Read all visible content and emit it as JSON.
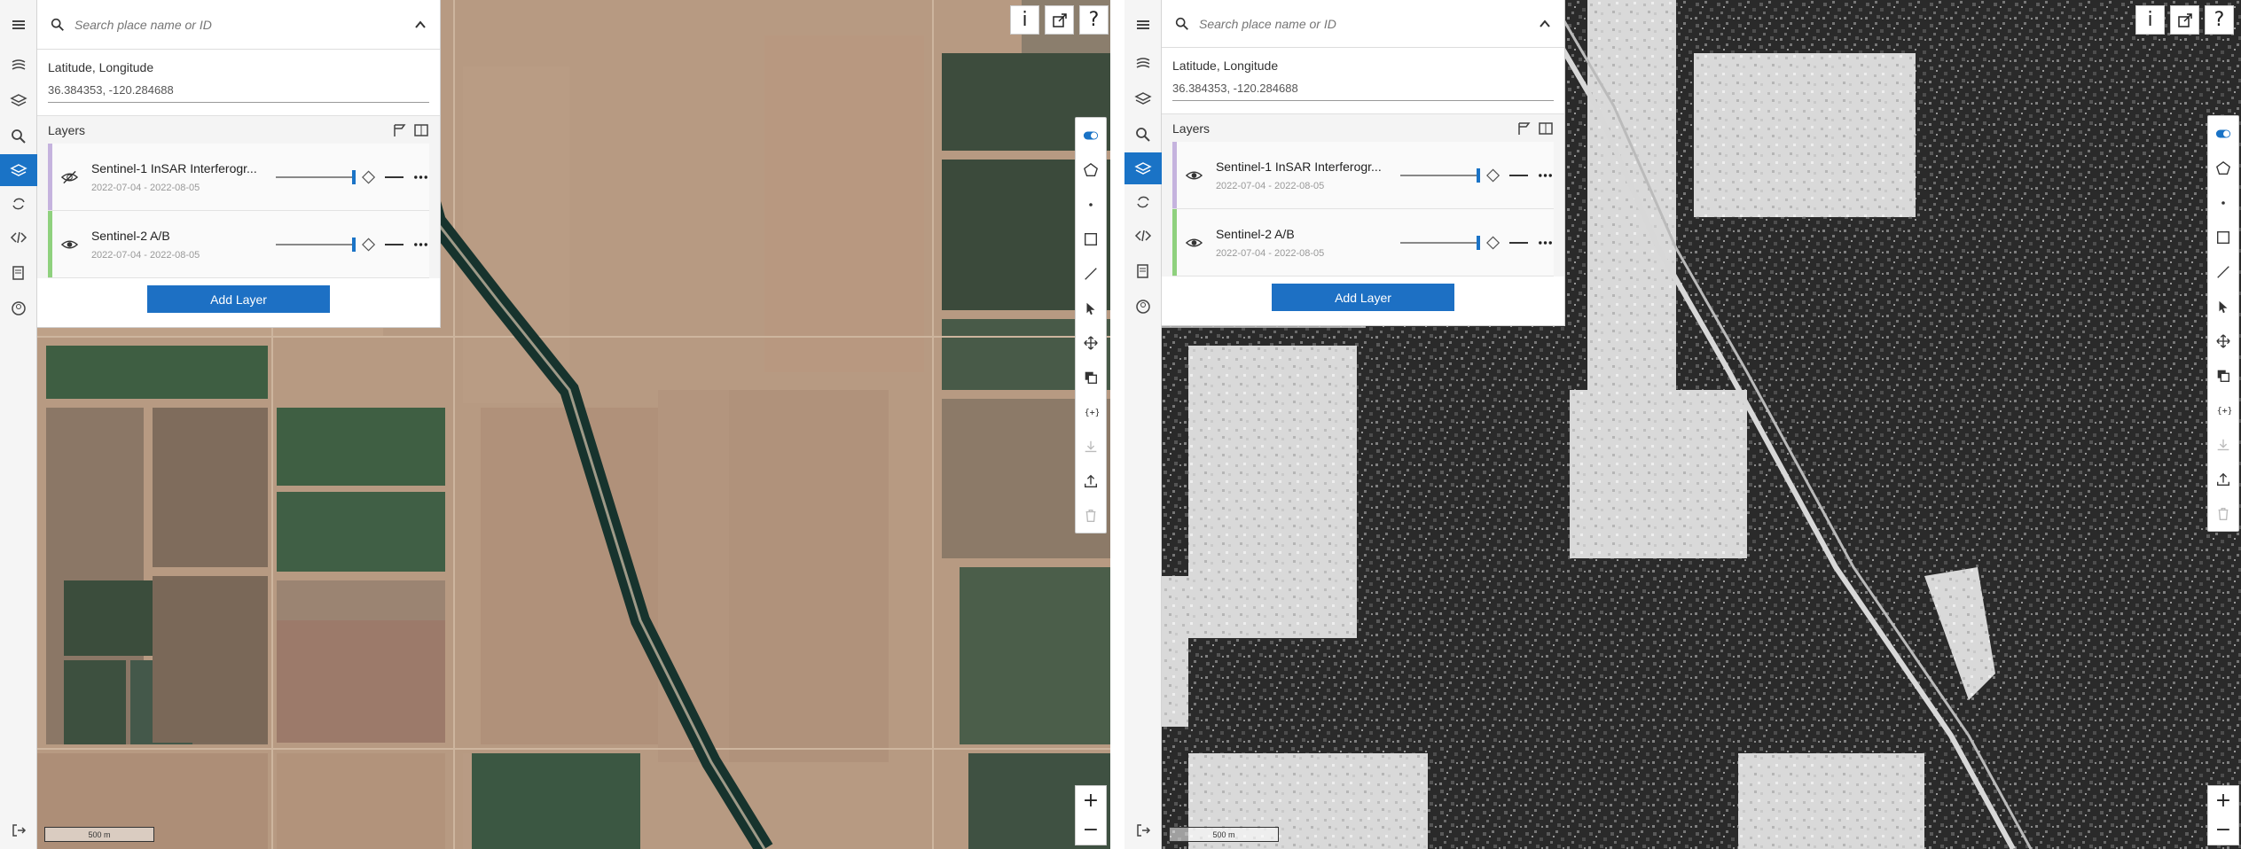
{
  "panes": [
    {
      "id": "left",
      "search": {
        "placeholder": "Search place name or ID"
      },
      "coordinates": {
        "label": "Latitude, Longitude",
        "value": "36.384353, -120.284688"
      },
      "layers": {
        "title": "Layers",
        "items": [
          {
            "name": "Sentinel-1 InSAR Interferogr...",
            "date_range": "2022-07-04 - 2022-08-05",
            "visible": false,
            "color": "#c5b3de",
            "opacity": 1.0
          },
          {
            "name": "Sentinel-2 A/B",
            "date_range": "2022-07-04 - 2022-08-05",
            "visible": true,
            "color": "#8fd17e",
            "opacity": 1.0
          }
        ],
        "add_label": "Add Layer"
      },
      "top_buttons": {
        "info": "i",
        "help": "?"
      },
      "zoom": {
        "in": "+",
        "out": "−"
      },
      "scale_label": "500 m"
    },
    {
      "id": "right",
      "search": {
        "placeholder": "Search place name or ID"
      },
      "coordinates": {
        "label": "Latitude, Longitude",
        "value": "36.384353, -120.284688"
      },
      "layers": {
        "title": "Layers",
        "items": [
          {
            "name": "Sentinel-1 InSAR Interferogr...",
            "date_range": "2022-07-04 - 2022-08-05",
            "visible": true,
            "color": "#c5b3de",
            "opacity": 1.0
          },
          {
            "name": "Sentinel-2 A/B",
            "date_range": "2022-07-04 - 2022-08-05",
            "visible": true,
            "color": "#8fd17e",
            "opacity": 1.0
          }
        ],
        "add_label": "Add Layer"
      },
      "top_buttons": {
        "info": "i",
        "help": "?"
      },
      "zoom": {
        "in": "+",
        "out": "−"
      },
      "scale_label": "500 m"
    }
  ],
  "colors": {
    "accent": "#1a73c6",
    "add_button": "#1d70c4"
  },
  "rail_icons": [
    "menu-icon",
    "datasets-icon",
    "layers-icon",
    "search-icon",
    "layer-stack-icon",
    "refresh-icon",
    "code-icon",
    "notes-icon",
    "account-icon",
    "logout-icon"
  ],
  "tool_icons": [
    "toggle-icon",
    "polygon-icon",
    "point-icon",
    "rectangle-icon",
    "line-icon",
    "select-icon",
    "move-icon",
    "copy-icon",
    "expression-icon",
    "download-icon",
    "upload-icon",
    "delete-icon"
  ]
}
